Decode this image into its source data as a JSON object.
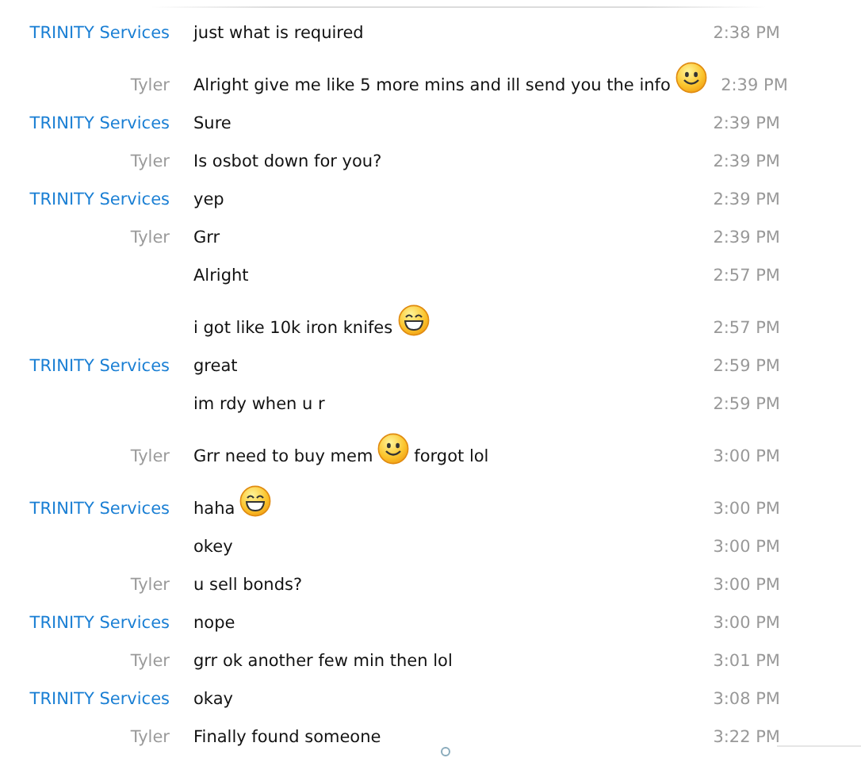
{
  "messages": [
    {
      "sender": {
        "name": "TRINITY Services",
        "kind": "contact"
      },
      "parts": [
        {
          "kind": "text",
          "text": "just what is required"
        }
      ],
      "time": "2:38 PM"
    },
    {
      "sender": {
        "name": "Tyler",
        "kind": "self"
      },
      "parts": [
        {
          "kind": "text",
          "text": "Alright give me like 5 more mins and ill send you the info"
        },
        {
          "kind": "smile"
        }
      ],
      "time": "2:39 PM"
    },
    {
      "sender": {
        "name": "TRINITY Services",
        "kind": "contact"
      },
      "parts": [
        {
          "kind": "text",
          "text": "Sure"
        }
      ],
      "time": "2:39 PM"
    },
    {
      "sender": {
        "name": "Tyler",
        "kind": "self"
      },
      "parts": [
        {
          "kind": "text",
          "text": "Is osbot down for you?"
        }
      ],
      "time": "2:39 PM"
    },
    {
      "sender": {
        "name": "TRINITY Services",
        "kind": "contact"
      },
      "parts": [
        {
          "kind": "text",
          "text": "yep"
        }
      ],
      "time": "2:39 PM"
    },
    {
      "sender": {
        "name": "Tyler",
        "kind": "self"
      },
      "parts": [
        {
          "kind": "text",
          "text": "Grr"
        }
      ],
      "time": "2:39 PM"
    },
    {
      "parts": [
        {
          "kind": "text",
          "text": "Alright"
        }
      ],
      "time": "2:57 PM"
    },
    {
      "parts": [
        {
          "kind": "text",
          "text": "i got like 10k iron knifes"
        },
        {
          "kind": "grin"
        }
      ],
      "time": "2:57 PM"
    },
    {
      "sender": {
        "name": "TRINITY Services",
        "kind": "contact"
      },
      "parts": [
        {
          "kind": "text",
          "text": "great"
        }
      ],
      "time": "2:59 PM"
    },
    {
      "parts": [
        {
          "kind": "text",
          "text": "im rdy when u r"
        }
      ],
      "time": "2:59 PM"
    },
    {
      "sender": {
        "name": "Tyler",
        "kind": "self"
      },
      "parts": [
        {
          "kind": "text",
          "text": "Grr need to buy mem"
        },
        {
          "kind": "smile"
        },
        {
          "kind": "text",
          "text": "forgot lol"
        }
      ],
      "time": "3:00 PM"
    },
    {
      "sender": {
        "name": "TRINITY Services",
        "kind": "contact"
      },
      "parts": [
        {
          "kind": "text",
          "text": "haha"
        },
        {
          "kind": "grin"
        }
      ],
      "time": "3:00 PM"
    },
    {
      "parts": [
        {
          "kind": "text",
          "text": "okey"
        }
      ],
      "time": "3:00 PM"
    },
    {
      "sender": {
        "name": "Tyler",
        "kind": "self"
      },
      "parts": [
        {
          "kind": "text",
          "text": "u sell bonds?"
        }
      ],
      "time": "3:00 PM"
    },
    {
      "sender": {
        "name": "TRINITY Services",
        "kind": "contact"
      },
      "parts": [
        {
          "kind": "text",
          "text": "nope"
        }
      ],
      "time": "3:00 PM"
    },
    {
      "sender": {
        "name": "Tyler",
        "kind": "self"
      },
      "parts": [
        {
          "kind": "text",
          "text": "grr ok another few min then lol"
        }
      ],
      "time": "3:01 PM"
    },
    {
      "sender": {
        "name": "TRINITY Services",
        "kind": "contact"
      },
      "parts": [
        {
          "kind": "text",
          "text": "okay"
        }
      ],
      "time": "3:08 PM"
    },
    {
      "sender": {
        "name": "Tyler",
        "kind": "self"
      },
      "parts": [
        {
          "kind": "text",
          "text": "Finally found someone"
        }
      ],
      "time": "3:22 PM"
    }
  ]
}
